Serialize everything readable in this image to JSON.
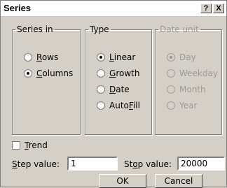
{
  "window": {
    "title": "Series",
    "help_button": "?",
    "close_button": "X"
  },
  "series_in": {
    "legend": "Series in",
    "options": [
      {
        "label": "Rows",
        "selected": false
      },
      {
        "label": "Columns",
        "selected": true
      }
    ]
  },
  "type": {
    "legend": "Type",
    "options": [
      {
        "label": "Linear",
        "selected": true
      },
      {
        "label": "Growth",
        "selected": false
      },
      {
        "label": "Date",
        "selected": false
      },
      {
        "label": "AutoFill",
        "selected": false
      }
    ]
  },
  "date_unit": {
    "legend": "Date unit",
    "enabled": false,
    "options": [
      {
        "label": "Day",
        "selected": true
      },
      {
        "label": "Weekday",
        "selected": false
      },
      {
        "label": "Month",
        "selected": false
      },
      {
        "label": "Year",
        "selected": false
      }
    ]
  },
  "trend": {
    "label": "Trend",
    "checked": false
  },
  "step": {
    "label": "Step value:",
    "value": "1"
  },
  "stop": {
    "label": "Stop value:",
    "value": "20000"
  },
  "buttons": {
    "ok": "OK",
    "cancel": "Cancel"
  }
}
